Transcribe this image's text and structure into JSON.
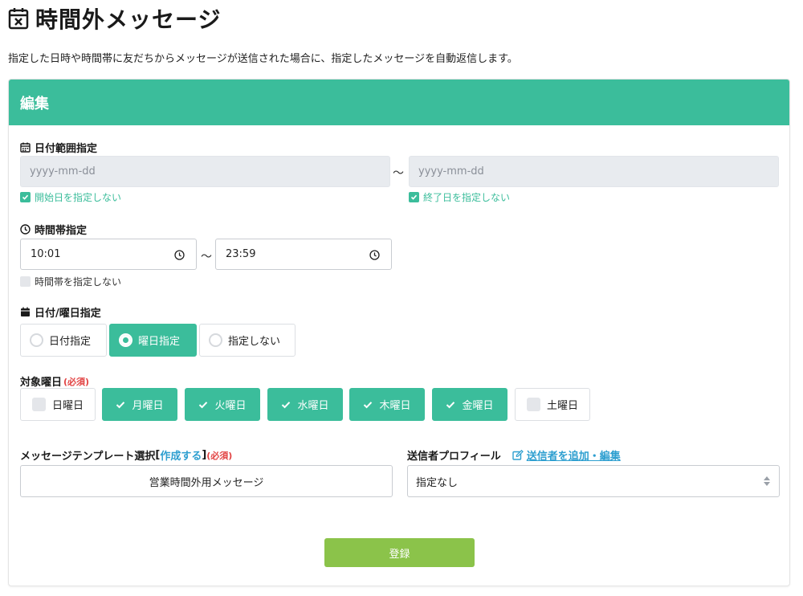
{
  "page": {
    "title": "時間外メッセージ",
    "description": "指定した日時や時間帯に友だちからメッセージが送信された場合に、指定したメッセージを自動返信します。"
  },
  "card": {
    "header": "編集"
  },
  "date_range": {
    "label": "日付範囲指定",
    "start_placeholder": "yyyy-mm-dd",
    "end_placeholder": "yyyy-mm-dd",
    "separator": "〜",
    "start_unset_label": "開始日を指定しない",
    "start_unset_checked": true,
    "end_unset_label": "終了日を指定しない",
    "end_unset_checked": true
  },
  "time_range": {
    "label": "時間帯指定",
    "start_value": "10:01",
    "end_value": "23:59",
    "separator": "〜",
    "unset_label": "時間帯を指定しない",
    "unset_checked": false
  },
  "date_or_weekday": {
    "label": "日付/曜日指定",
    "options": [
      {
        "label": "日付指定",
        "selected": false
      },
      {
        "label": "曜日指定",
        "selected": true
      },
      {
        "label": "指定しない",
        "selected": false
      }
    ]
  },
  "weekdays": {
    "label": "対象曜日",
    "required": "(必須)",
    "days": [
      {
        "label": "日曜日",
        "checked": false
      },
      {
        "label": "月曜日",
        "checked": true
      },
      {
        "label": "火曜日",
        "checked": true
      },
      {
        "label": "水曜日",
        "checked": true
      },
      {
        "label": "木曜日",
        "checked": true
      },
      {
        "label": "金曜日",
        "checked": true
      },
      {
        "label": "土曜日",
        "checked": false
      }
    ]
  },
  "template": {
    "label": "メッセージテンプレート選択",
    "bracket_open": "[",
    "create_link": "作成する",
    "bracket_close": "]",
    "required": "(必須)",
    "selected": "営業時間外用メッセージ"
  },
  "sender": {
    "label": "送信者プロフィール",
    "edit_link": "送信者を追加・編集",
    "selected": "指定なし"
  },
  "submit": {
    "label": "登録"
  },
  "colors": {
    "accent": "#3bbd9b",
    "submit": "#8bc34a",
    "link": "#2e9fd0",
    "required": "#e24343"
  }
}
